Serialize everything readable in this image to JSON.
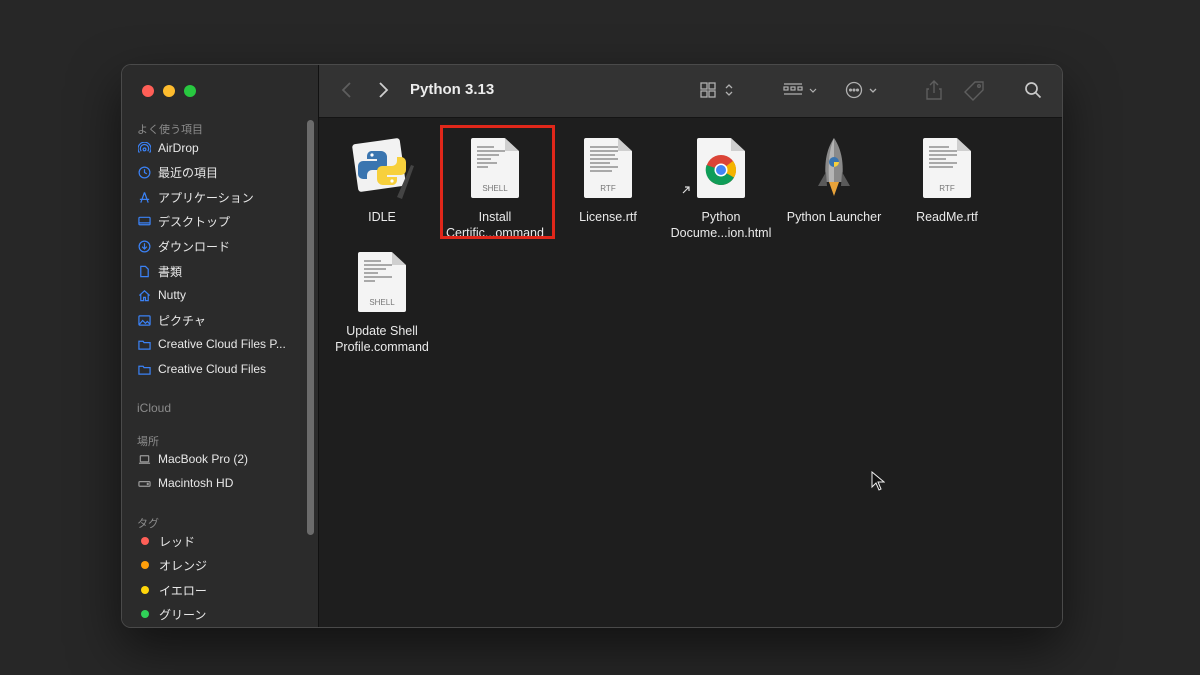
{
  "window": {
    "title": "Python 3.13"
  },
  "sidebar": {
    "favorites_label": "よく使う項目",
    "favorites": [
      {
        "label": "AirDrop",
        "icon": "airdrop-icon"
      },
      {
        "label": "最近の項目",
        "icon": "clock-icon"
      },
      {
        "label": "アプリケーション",
        "icon": "applications-icon"
      },
      {
        "label": "デスクトップ",
        "icon": "desktop-icon"
      },
      {
        "label": "ダウンロード",
        "icon": "download-icon"
      },
      {
        "label": "書類",
        "icon": "document-icon"
      },
      {
        "label": "Nutty",
        "icon": "home-icon"
      },
      {
        "label": "ピクチャ",
        "icon": "pictures-icon"
      },
      {
        "label": "Creative Cloud Files P...",
        "icon": "folder-icon"
      },
      {
        "label": "Creative Cloud Files",
        "icon": "folder-icon"
      }
    ],
    "icloud_label": "iCloud",
    "places_label": "場所",
    "places": [
      {
        "label": "MacBook Pro (2)",
        "icon": "laptop-icon"
      },
      {
        "label": "Macintosh HD",
        "icon": "disk-icon"
      }
    ],
    "tags_label": "タグ",
    "tags": [
      {
        "label": "レッド",
        "color": "#ff5f57"
      },
      {
        "label": "オレンジ",
        "color": "#ff9f0a"
      },
      {
        "label": "イエロー",
        "color": "#ffd60a"
      },
      {
        "label": "グリーン",
        "color": "#30d158"
      }
    ]
  },
  "files": [
    {
      "line1": "IDLE",
      "line2": "",
      "icon": "idle-icon"
    },
    {
      "line1": "Install",
      "line2": "Certific...ommand",
      "icon": "shell-script-icon",
      "badge": "SHELL"
    },
    {
      "line1": "License.rtf",
      "line2": "",
      "icon": "rtf-document-icon",
      "badge": "RTF"
    },
    {
      "line1": "Python",
      "line2": "Docume...ion.html",
      "icon": "chrome-html-icon"
    },
    {
      "line1": "Python Launcher",
      "line2": "",
      "icon": "rocket-icon"
    },
    {
      "line1": "ReadMe.rtf",
      "line2": "",
      "icon": "rtf-document-icon",
      "badge": "RTF"
    },
    {
      "line1": "Update Shell",
      "line2": "Profile.command",
      "icon": "shell-script-icon",
      "badge": "SHELL"
    }
  ],
  "colors": {
    "accent": "#3b82f6",
    "highlight": "#e0271a"
  }
}
